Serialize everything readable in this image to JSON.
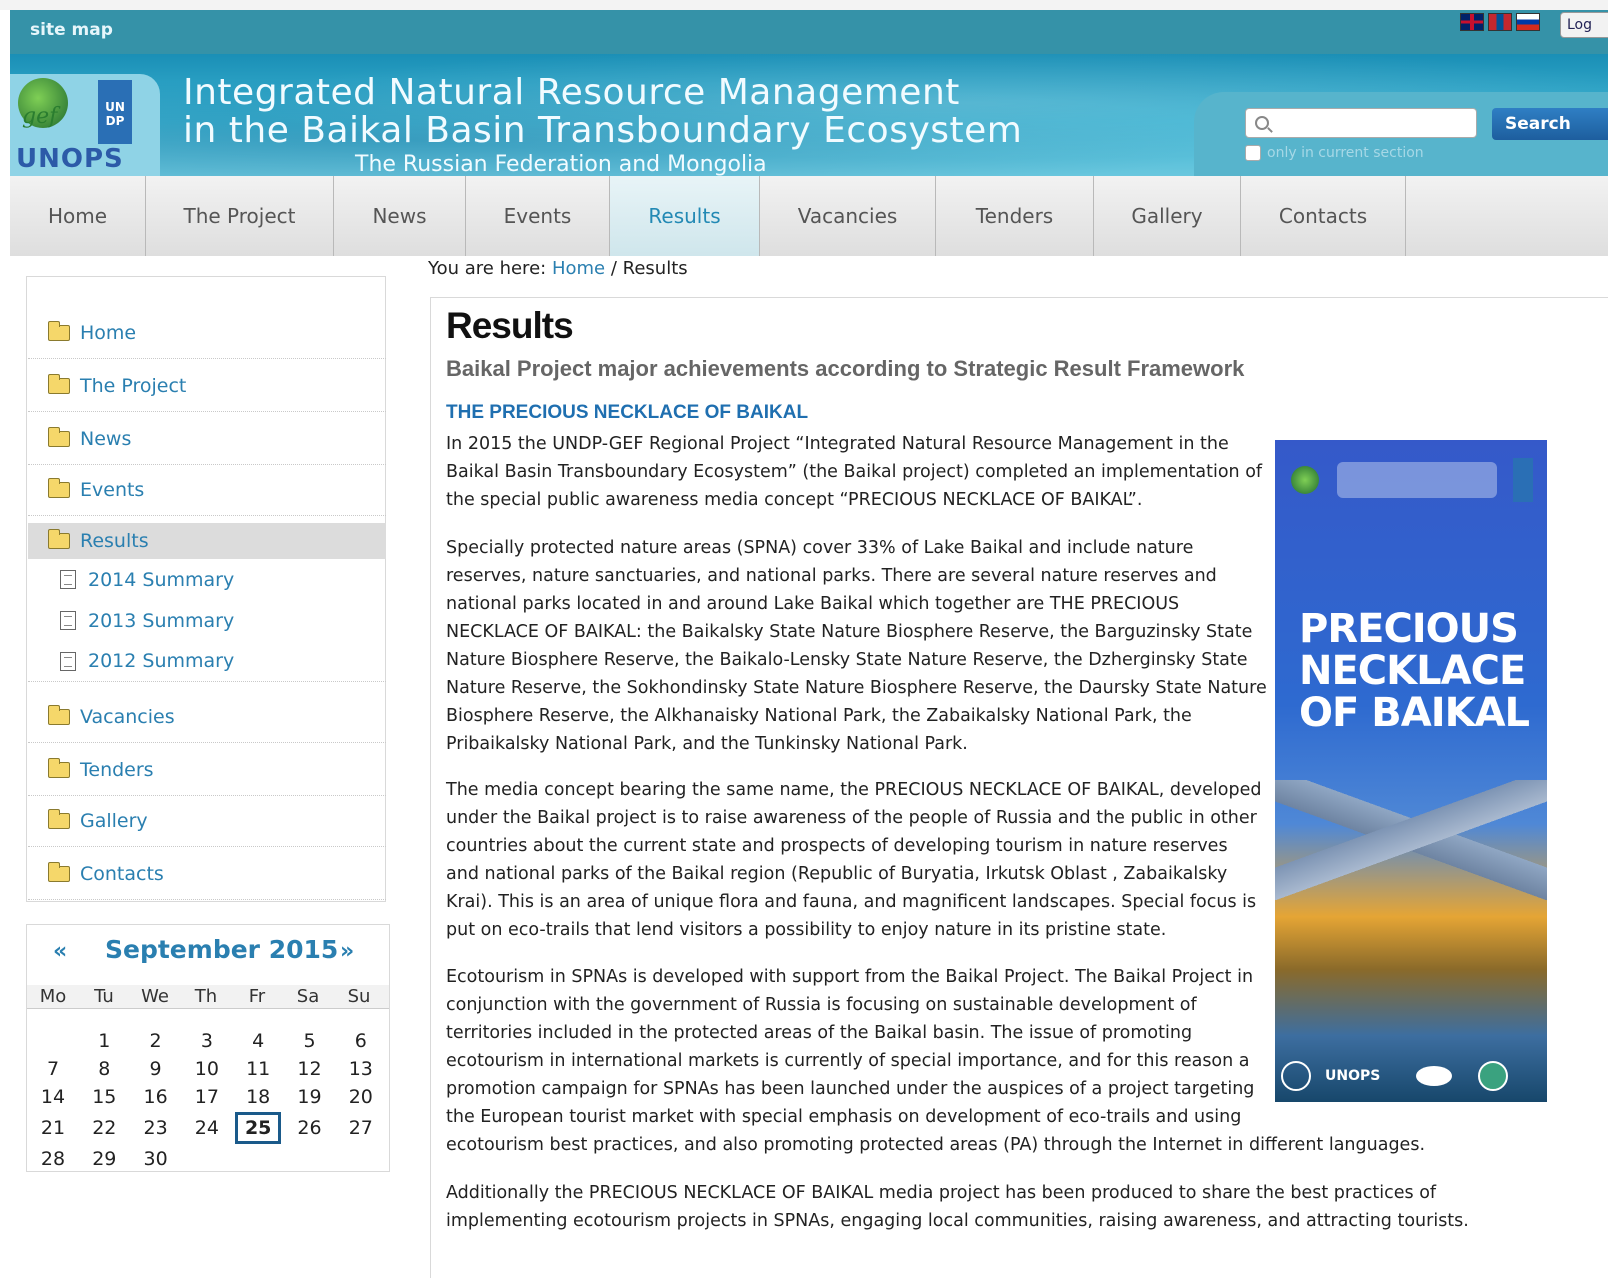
{
  "topbar": {
    "site_map": "site map",
    "login": "Log"
  },
  "banner": {
    "title_line1": "Integrated Natural Resource Management",
    "title_line2": "in the Baikal Basin Transboundary Ecosystem",
    "subtitle": "The Russian Federation and Mongolia",
    "logo_gef": "gef",
    "logo_undp": "UN DP",
    "logo_unops": "UNOPS"
  },
  "search": {
    "placeholder": "",
    "button": "Search",
    "only_section": "only in current section"
  },
  "nav": {
    "items": [
      {
        "label": "Home"
      },
      {
        "label": "The Project"
      },
      {
        "label": "News"
      },
      {
        "label": "Events"
      },
      {
        "label": "Results"
      },
      {
        "label": "Vacancies"
      },
      {
        "label": "Tenders"
      },
      {
        "label": "Gallery"
      },
      {
        "label": "Contacts"
      }
    ],
    "active": "Results"
  },
  "sidebar": {
    "items": [
      {
        "label": "Home"
      },
      {
        "label": "The Project"
      },
      {
        "label": "News"
      },
      {
        "label": "Events"
      },
      {
        "label": "Results"
      },
      {
        "label": "Vacancies"
      },
      {
        "label": "Tenders"
      },
      {
        "label": "Gallery"
      },
      {
        "label": "Contacts"
      }
    ],
    "subitems": [
      {
        "label": "2014 Summary"
      },
      {
        "label": "2013 Summary"
      },
      {
        "label": "2012 Summary"
      }
    ]
  },
  "calendar": {
    "prev": "«",
    "next": "»",
    "title": "September 2015",
    "weekdays": [
      "Mo",
      "Tu",
      "We",
      "Th",
      "Fr",
      "Sa",
      "Su"
    ],
    "today": "25",
    "days": [
      "1",
      "2",
      "3",
      "4",
      "5",
      "6",
      "7",
      "8",
      "9",
      "10",
      "11",
      "12",
      "13",
      "14",
      "15",
      "16",
      "17",
      "18",
      "19",
      "20",
      "21",
      "22",
      "23",
      "24",
      "25",
      "26",
      "27",
      "28",
      "29",
      "30"
    ]
  },
  "breadcrumb": {
    "prefix": "You are here:",
    "home": "Home",
    "sep": "/",
    "current": "Results"
  },
  "main": {
    "title": "Results",
    "lead": "Baikal Project major achievements according to Strategic Result Framework",
    "section_head": "THE PRECIOUS NECKLACE OF BAIKAL",
    "p1": [
      "In 2015 the UNDP-GEF Regional Project “Integrated Natural Resource Management in the",
      "Baikal Basin Transboundary Ecosystem” (the Baikal project) completed an implementation of",
      "the special public awareness media concept “PRECIOUS NECKLACE OF BAIKAL”."
    ],
    "p2": [
      "Specially protected nature areas (SPNA) cover 33% of Lake Baikal and include nature",
      "reserves, nature sanctuaries, and national parks. There are several nature reserves and",
      "national parks located in and around Lake Baikal which together are THE PRECIOUS",
      "NECKLACE OF BAIKAL: the Baikalsky State Nature Biosphere Reserve, the Barguzinsky State",
      "Nature Biosphere Reserve, the Baikalo-Lensky State Nature Reserve, the Dzherginsky State",
      "Nature Reserve, the Sokhondinsky State Nature Biosphere Reserve, the Daursky State Nature",
      "Biosphere Reserve, the Alkhanaisky National Park, the Zabaikalsky National Park, the",
      "Pribaikalsky National Park, and the Tunkinsky National Park."
    ],
    "p3": [
      "The media concept bearing the same name, the PRECIOUS NECKLACE OF BAIKAL, developed",
      "under the Baikal project is to raise awareness of the people of Russia and the public in other",
      "countries about the current state and prospects of developing tourism in nature reserves",
      "and national parks of the Baikal region (Republic of Buryatia, Irkutsk Oblast , Zabaikalsky",
      "Krai). This is an area of unique flora and fauna, and magnificent landscapes. Special focus is",
      "put on eco-trails that lend visitors a possibility to enjoy nature in its pristine state."
    ],
    "p4": [
      "Ecotourism in SPNAs is developed with support from the Baikal Project. The Baikal Project in",
      "conjunction with the government of Russia is focusing on sustainable development of",
      "territories included in the protected areas of the Baikal basin. The issue of promoting",
      "ecotourism in international markets is currently of special importance, and for this reason a",
      "promotion campaign for SPNAs has been launched under the auspices of a project targeting",
      "the European tourist market with special emphasis on development of eco-trails and using",
      "ecotourism best practices, and also promoting protected areas (PA) through the Internet in different languages."
    ],
    "p5": [
      "Additionally the PRECIOUS NECKLACE OF BAIKAL media project has been produced to share the best practices of",
      "implementing ecotourism projects in SPNAs, engaging local communities, raising awareness, and attracting tourists."
    ]
  },
  "poster": {
    "title_l1": "PRECIOUS",
    "title_l2": "NECKLACE",
    "title_l3": "OF BAIKAL",
    "unops": "UNOPS"
  }
}
